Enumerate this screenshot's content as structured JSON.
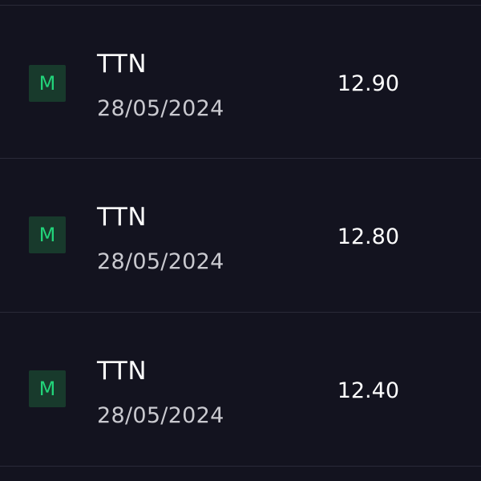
{
  "trades": [
    {
      "badge": "M",
      "ticker": "TTN",
      "date": "28/05/2024",
      "price": "12.90"
    },
    {
      "badge": "M",
      "ticker": "TTN",
      "date": "28/05/2024",
      "price": "12.80"
    },
    {
      "badge": "M",
      "ticker": "TTN",
      "date": "28/05/2024",
      "price": "12.40"
    }
  ],
  "colors": {
    "background": "#13131f",
    "divider": "#2a2a38",
    "badge_bg": "#183a2c",
    "badge_text": "#22d47a",
    "primary_text": "#ffffff",
    "secondary_text": "#c9c9cf"
  }
}
